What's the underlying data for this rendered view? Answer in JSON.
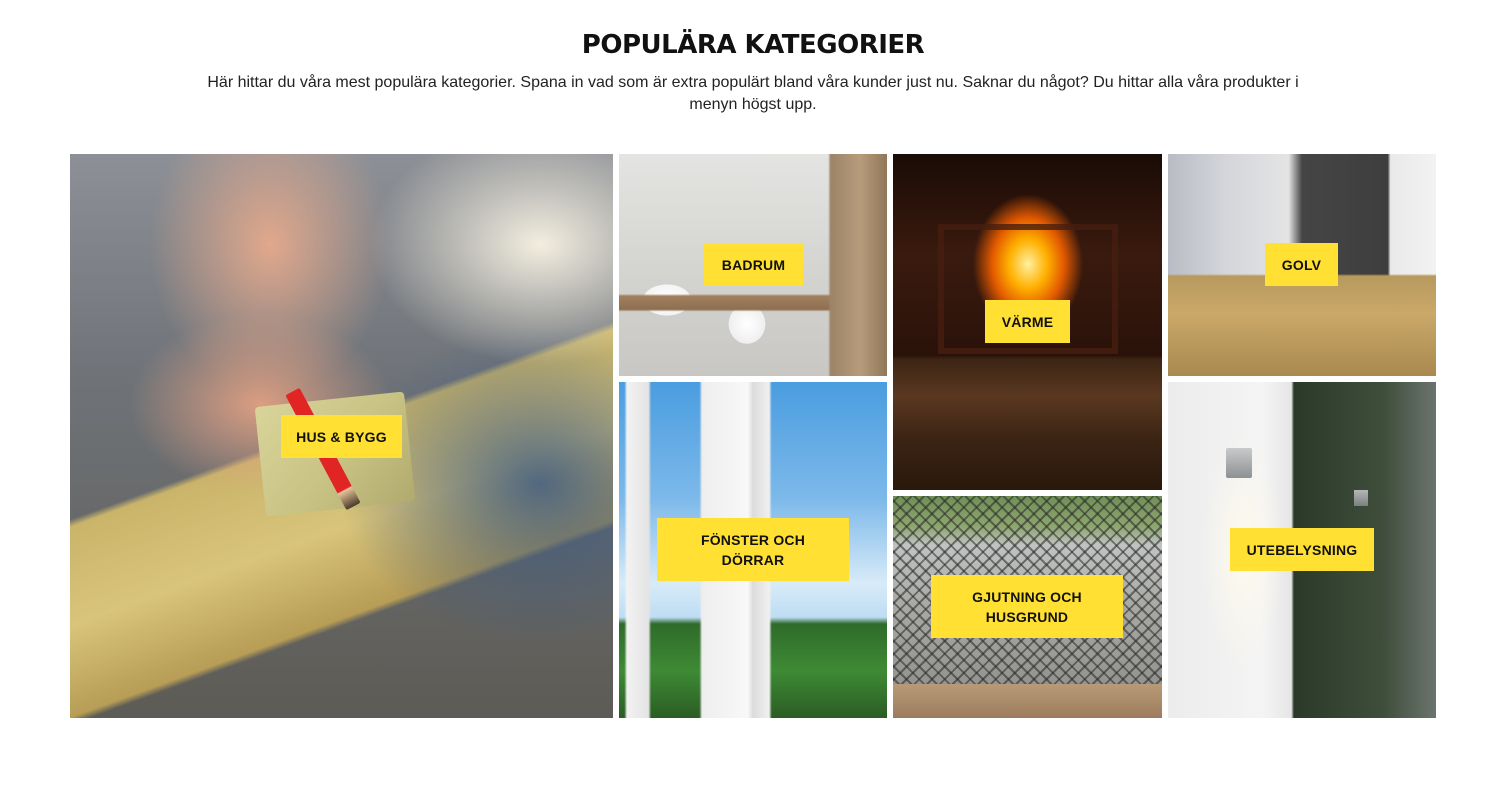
{
  "section": {
    "title": "POPULÄRA KATEGORIER",
    "description": "Här hittar du våra mest populära kategorier. Spana in vad som är extra populärt bland våra kunder just nu. Saknar du något? Du hittar alla våra produkter i menyn högst upp."
  },
  "categories": [
    {
      "label": "HUS & BYGG"
    },
    {
      "label": "BADRUM"
    },
    {
      "label": "VÄRME"
    },
    {
      "label": "GOLV"
    },
    {
      "label": "FÖNSTER OCH DÖRRAR"
    },
    {
      "label": "GJUTNING OCH HUSGRUND"
    },
    {
      "label": "UTEBELYSNING"
    }
  ],
  "colors": {
    "label_background": "#ffe033",
    "text": "#111111"
  }
}
